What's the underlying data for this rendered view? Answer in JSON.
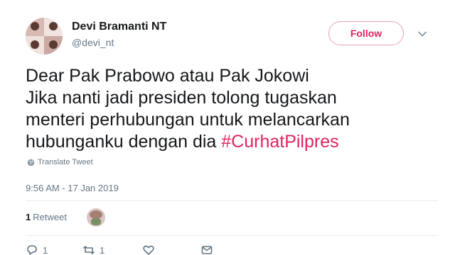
{
  "user": {
    "display_name": "Devi Bramanti NT",
    "handle": "@devi_nt"
  },
  "follow_label": "Follow",
  "tweet": {
    "lines": [
      "Dear Pak Prabowo atau Pak Jokowi",
      "Jika nanti jadi presiden tolong tugaskan",
      "menteri perhubungan untuk melancarkan"
    ],
    "last_line_text": "hubunganku dengan dia ",
    "hashtag": "#CurhatPilpres"
  },
  "translate_label": "Translate Tweet",
  "timestamp": "9:56 AM - 17 Jan 2019",
  "stats": {
    "retweet_count": "1",
    "retweet_label": "Retweet"
  },
  "actions": {
    "reply_count": "1",
    "retweet_count": "1"
  },
  "colors": {
    "accent": "#e0245e",
    "muted": "#657786"
  }
}
